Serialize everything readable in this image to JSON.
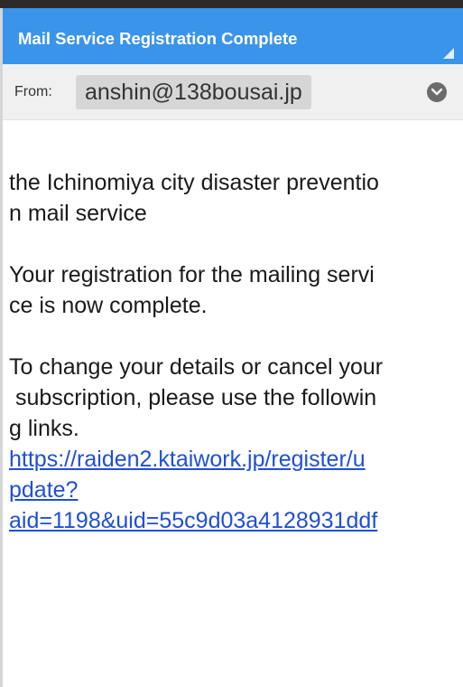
{
  "header": {
    "title": "Mail Service Registration Complete"
  },
  "from": {
    "label": "From:",
    "address": "anshin@138bousai.jp"
  },
  "message": {
    "line1": "the Ichinomiya city disaster preventio",
    "line2": "n mail service",
    "line3": "Your registration for the mailing servi",
    "line4": "ce is now complete.",
    "line5": "To change your details or cancel your",
    "line6": " subscription, please use the followin",
    "line7": "g links.",
    "link1": "https://raiden2.ktaiwork.jp/register/u",
    "link2": "pdate?",
    "link3": "aid=1198&uid=55c9d03a4128931ddf"
  },
  "colors": {
    "header_bg": "#3a94ea",
    "link": "#1f4fd6"
  },
  "icons": {
    "expand": "chevron-down-icon",
    "corner": "corner-triangle-icon"
  }
}
